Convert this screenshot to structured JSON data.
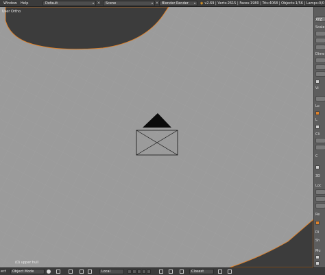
{
  "topbar": {
    "menus": [
      "Window",
      "Help"
    ],
    "layout_value": "Default",
    "scene_value": "Scene",
    "render_engine": "Blender Render",
    "stats": "v2.69 | Verts:2615 | Faces:1980 | Tris:4068 | Objects:1/56 | Lamps:0/0"
  },
  "viewport": {
    "view_label": "User Ortho",
    "object_label": "(0) upper hull"
  },
  "rightpanel": {
    "labels": [
      "XYZ",
      "Scale",
      "Dime",
      "Vi",
      "Lo",
      "L",
      "Cli",
      "C",
      "3D",
      "Loc",
      "Re",
      "Di",
      "Sh",
      "Mu"
    ]
  },
  "bottombar": {
    "first": "ect",
    "mode": "Object Mode",
    "pivot": "Local",
    "snap": "Closest"
  },
  "colors": {
    "header": "#3b3b3b",
    "viewport": "#9b9b9b",
    "mesh_dark": "#3c3c3c",
    "selection_outline": "#e0822a"
  }
}
